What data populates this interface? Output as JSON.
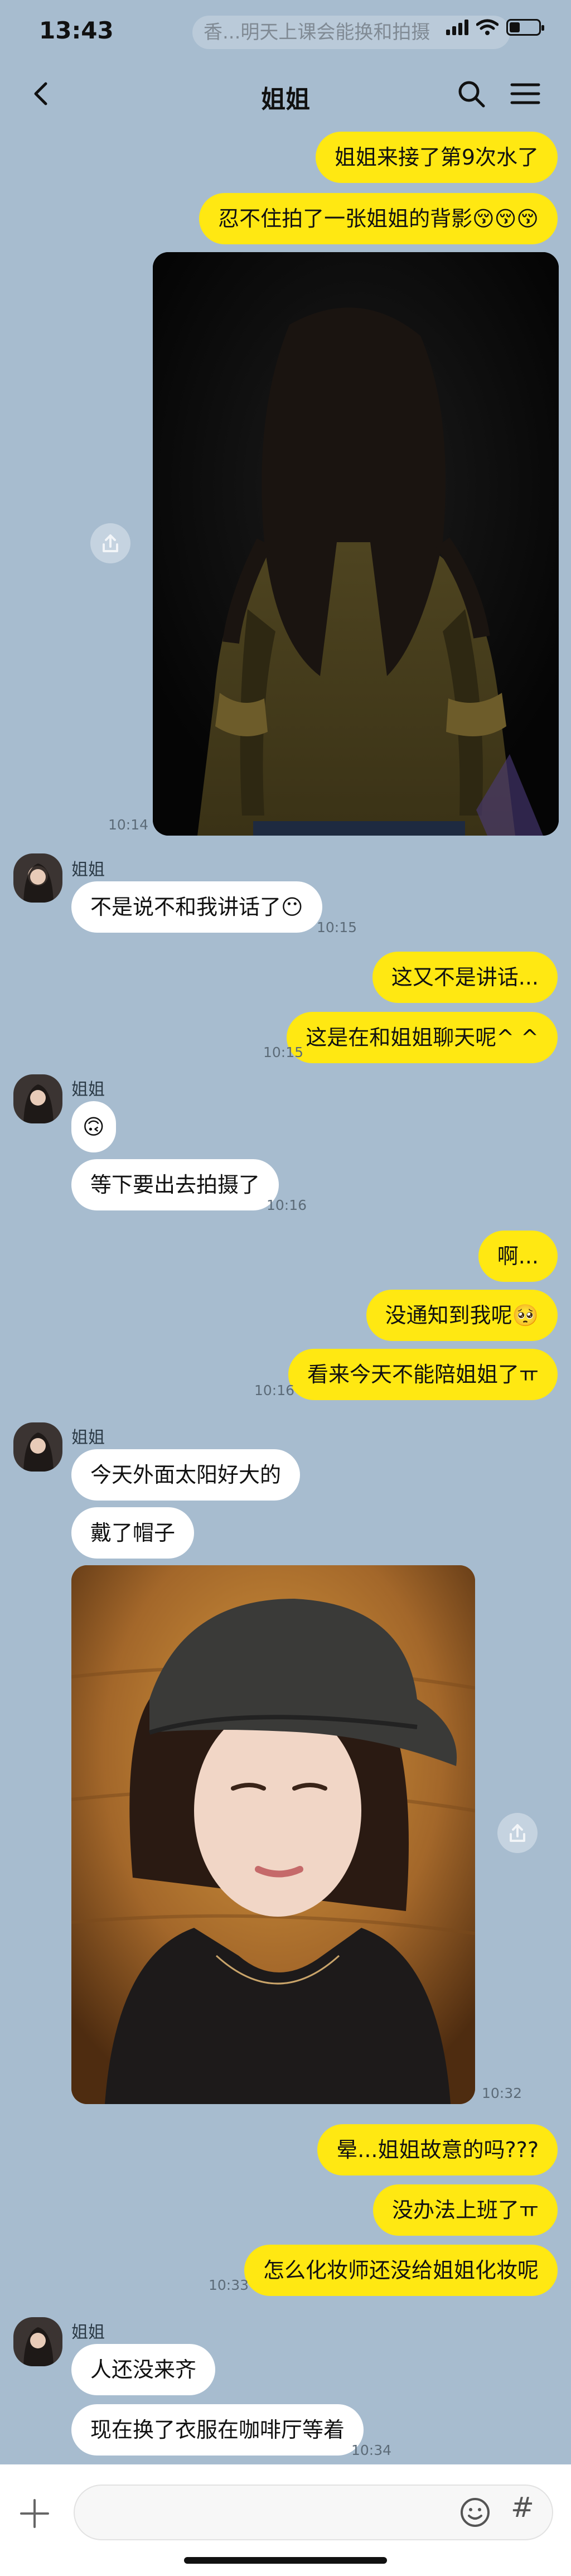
{
  "status_bar": {
    "time": "13:43",
    "preview": "香...明天上课会能换和拍摄",
    "battery_level": 0.35
  },
  "header": {
    "title": "姐姐",
    "back_icon": "chevron-left-icon",
    "search_icon": "search-icon",
    "menu_icon": "hamburger-menu-icon"
  },
  "colors": {
    "background": "#a7bccf",
    "outgoing_bubble": "#ffe812",
    "incoming_bubble": "#ffffff"
  },
  "messages": {
    "m1": "姐姐来接了第9次水了",
    "m2": "忍不住拍了一张姐姐的背影😚😚😚",
    "t1": "10:14",
    "s1": "姐姐",
    "m3": "不是说不和我讲话了😶",
    "t2": "10:15",
    "m4": "这又不是讲话...",
    "m5": "这是在和姐姐聊天呢^ ^",
    "t3": "10:15",
    "s2": "姐姐",
    "m6": "🙃",
    "m7": "等下要出去拍摄了",
    "t4": "10:16",
    "m8": "啊...",
    "m9": "没通知到我呢🥺",
    "m10": "看来今天不能陪姐姐了ㅠ",
    "t5": "10:16",
    "s3": "姐姐",
    "m11": "今天外面太阳好大的",
    "m12": "戴了帽子",
    "t6": "10:32",
    "m13": "晕...姐姐故意的吗???",
    "m14": "没办法上班了ㅠ",
    "m15": "怎么化妆师还没给姐姐化妆呢",
    "t7": "10:33",
    "s4": "姐姐",
    "m16": "人还没来齐",
    "m17": "现在换了衣服在咖啡厅等着",
    "t8": "10:34"
  },
  "input": {
    "value": "",
    "placeholder": "",
    "plus_icon": "plus-icon",
    "emoji_icon": "emoji-icon",
    "hash_label": "#"
  }
}
